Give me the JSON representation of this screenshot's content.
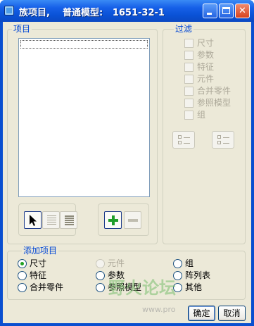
{
  "window": {
    "title": "族项目,    普通模型:   1651-32-1"
  },
  "items_group": {
    "legend": "项目"
  },
  "filter_group": {
    "legend": "过滤",
    "checkboxes": [
      {
        "label": "尺寸",
        "checked": false,
        "enabled": false
      },
      {
        "label": "参数",
        "checked": false,
        "enabled": false
      },
      {
        "label": "特征",
        "checked": false,
        "enabled": false
      },
      {
        "label": "元件",
        "checked": false,
        "enabled": false
      },
      {
        "label": "合并零件",
        "checked": false,
        "enabled": false
      },
      {
        "label": "参照模型",
        "checked": false,
        "enabled": false
      },
      {
        "label": "组",
        "checked": false,
        "enabled": false
      }
    ]
  },
  "add_group": {
    "legend": "添加项目",
    "options": [
      {
        "label": "尺寸",
        "selected": true,
        "enabled": true
      },
      {
        "label": "元件",
        "selected": false,
        "enabled": false
      },
      {
        "label": "组",
        "selected": false,
        "enabled": true
      },
      {
        "label": "特征",
        "selected": false,
        "enabled": true
      },
      {
        "label": "参数",
        "selected": false,
        "enabled": true
      },
      {
        "label": "阵列表",
        "selected": false,
        "enabled": true
      },
      {
        "label": "合并零件",
        "selected": false,
        "enabled": true
      },
      {
        "label": "参照模型",
        "selected": false,
        "enabled": true
      },
      {
        "label": "其他",
        "selected": false,
        "enabled": true
      }
    ]
  },
  "buttons": {
    "ok": "确定",
    "cancel": "取消"
  },
  "watermark": {
    "text": "野火论坛",
    "url": "www.pro"
  },
  "colors": {
    "titlebar": "#0a52d6",
    "dialog_bg": "#ece9d8",
    "legend_text": "#0046d5",
    "disabled_text": "#aca899"
  }
}
